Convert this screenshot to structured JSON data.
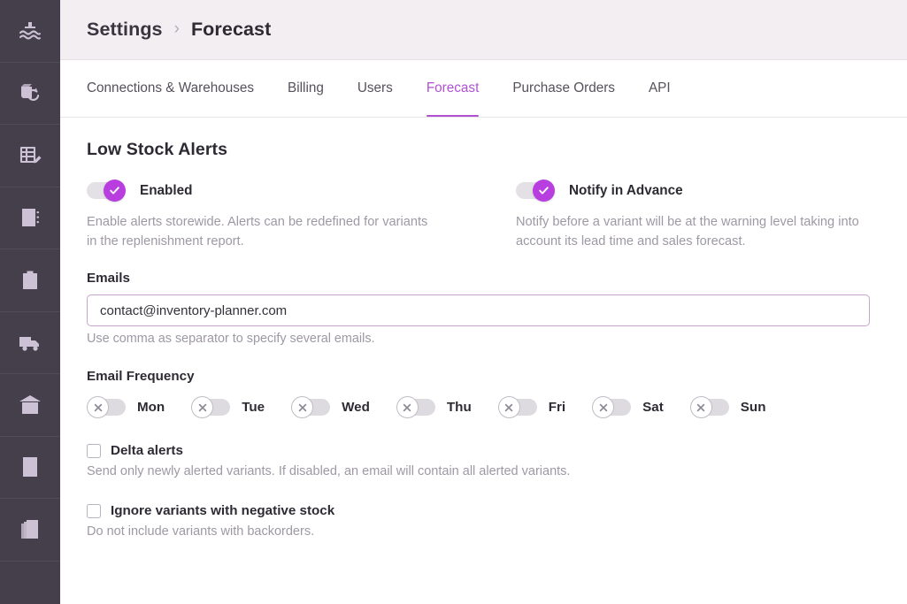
{
  "sidebar": {
    "items": [
      {
        "name": "dashboard",
        "icon": "waves-dashboard-icon"
      },
      {
        "name": "replenishment",
        "icon": "box-refresh-icon"
      },
      {
        "name": "forecast-edit",
        "icon": "table-pencil-icon"
      },
      {
        "name": "vendors",
        "icon": "address-book-icon"
      },
      {
        "name": "purchase-orders",
        "icon": "clipboard-check-icon"
      },
      {
        "name": "shipments",
        "icon": "truck-check-icon"
      },
      {
        "name": "warehouses",
        "icon": "warehouse-icon"
      },
      {
        "name": "calculations",
        "icon": "calculator-icon"
      },
      {
        "name": "reports",
        "icon": "report-chart-icon"
      }
    ]
  },
  "header": {
    "breadcrumb_root": "Settings",
    "breadcrumb_separator": "›",
    "breadcrumb_current": "Forecast"
  },
  "tabs": [
    {
      "label": "Connections & Warehouses",
      "active": false
    },
    {
      "label": "Billing",
      "active": false
    },
    {
      "label": "Users",
      "active": false
    },
    {
      "label": "Forecast",
      "active": true
    },
    {
      "label": "Purchase Orders",
      "active": false
    },
    {
      "label": "API",
      "active": false
    }
  ],
  "main": {
    "section_title": "Low Stock Alerts",
    "enabled_toggle": {
      "label": "Enabled",
      "state": "on",
      "description": "Enable alerts storewide. Alerts can be redefined for variants in the replenishment report."
    },
    "notify_toggle": {
      "label": "Notify in Advance",
      "state": "on",
      "description": "Notify before a variant will be at the warning level taking into account its lead time and sales forecast."
    },
    "emails": {
      "label": "Emails",
      "value": "contact@inventory-planner.com",
      "placeholder": "contact@inventory-planner.com",
      "hint": "Use comma as separator to specify several emails."
    },
    "email_frequency": {
      "label": "Email Frequency",
      "days": [
        {
          "label": "Mon",
          "state": "off"
        },
        {
          "label": "Tue",
          "state": "off"
        },
        {
          "label": "Wed",
          "state": "off"
        },
        {
          "label": "Thu",
          "state": "off"
        },
        {
          "label": "Fri",
          "state": "off"
        },
        {
          "label": "Sat",
          "state": "off"
        },
        {
          "label": "Sun",
          "state": "off"
        }
      ]
    },
    "delta_alerts": {
      "label": "Delta alerts",
      "checked": false,
      "description": "Send only newly alerted variants. If disabled, an email will contain all alerted variants."
    },
    "ignore_negative": {
      "label": "Ignore variants with negative stock",
      "checked": false,
      "description": "Do not include variants with backorders."
    }
  },
  "colors": {
    "accent_purple": "#b052d0",
    "toggle_on": "#b83ee0",
    "sidebar_bg": "#453f4c",
    "header_bg": "#f3eef2",
    "input_border": "#c8a3cd",
    "muted_text": "#9e98a4"
  }
}
